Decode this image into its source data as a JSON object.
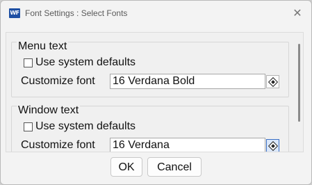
{
  "window": {
    "app_icon_text": "WF",
    "title": "Font Settings : Select Fonts",
    "close_glyph": "✕"
  },
  "groups": [
    {
      "label": "Menu text",
      "checkbox_label": "Use system defaults",
      "checkbox_checked": false,
      "font_label": "Customize font",
      "font_value": "16 Verdana Bold",
      "picker_icon": "font-picker-icon"
    },
    {
      "label": "Window text",
      "checkbox_label": "Use system defaults",
      "checkbox_checked": false,
      "font_label": "Customize font",
      "font_value": "16 Verdana",
      "picker_icon": "font-picker-icon"
    }
  ],
  "buttons": {
    "ok": "OK",
    "cancel": "Cancel"
  }
}
